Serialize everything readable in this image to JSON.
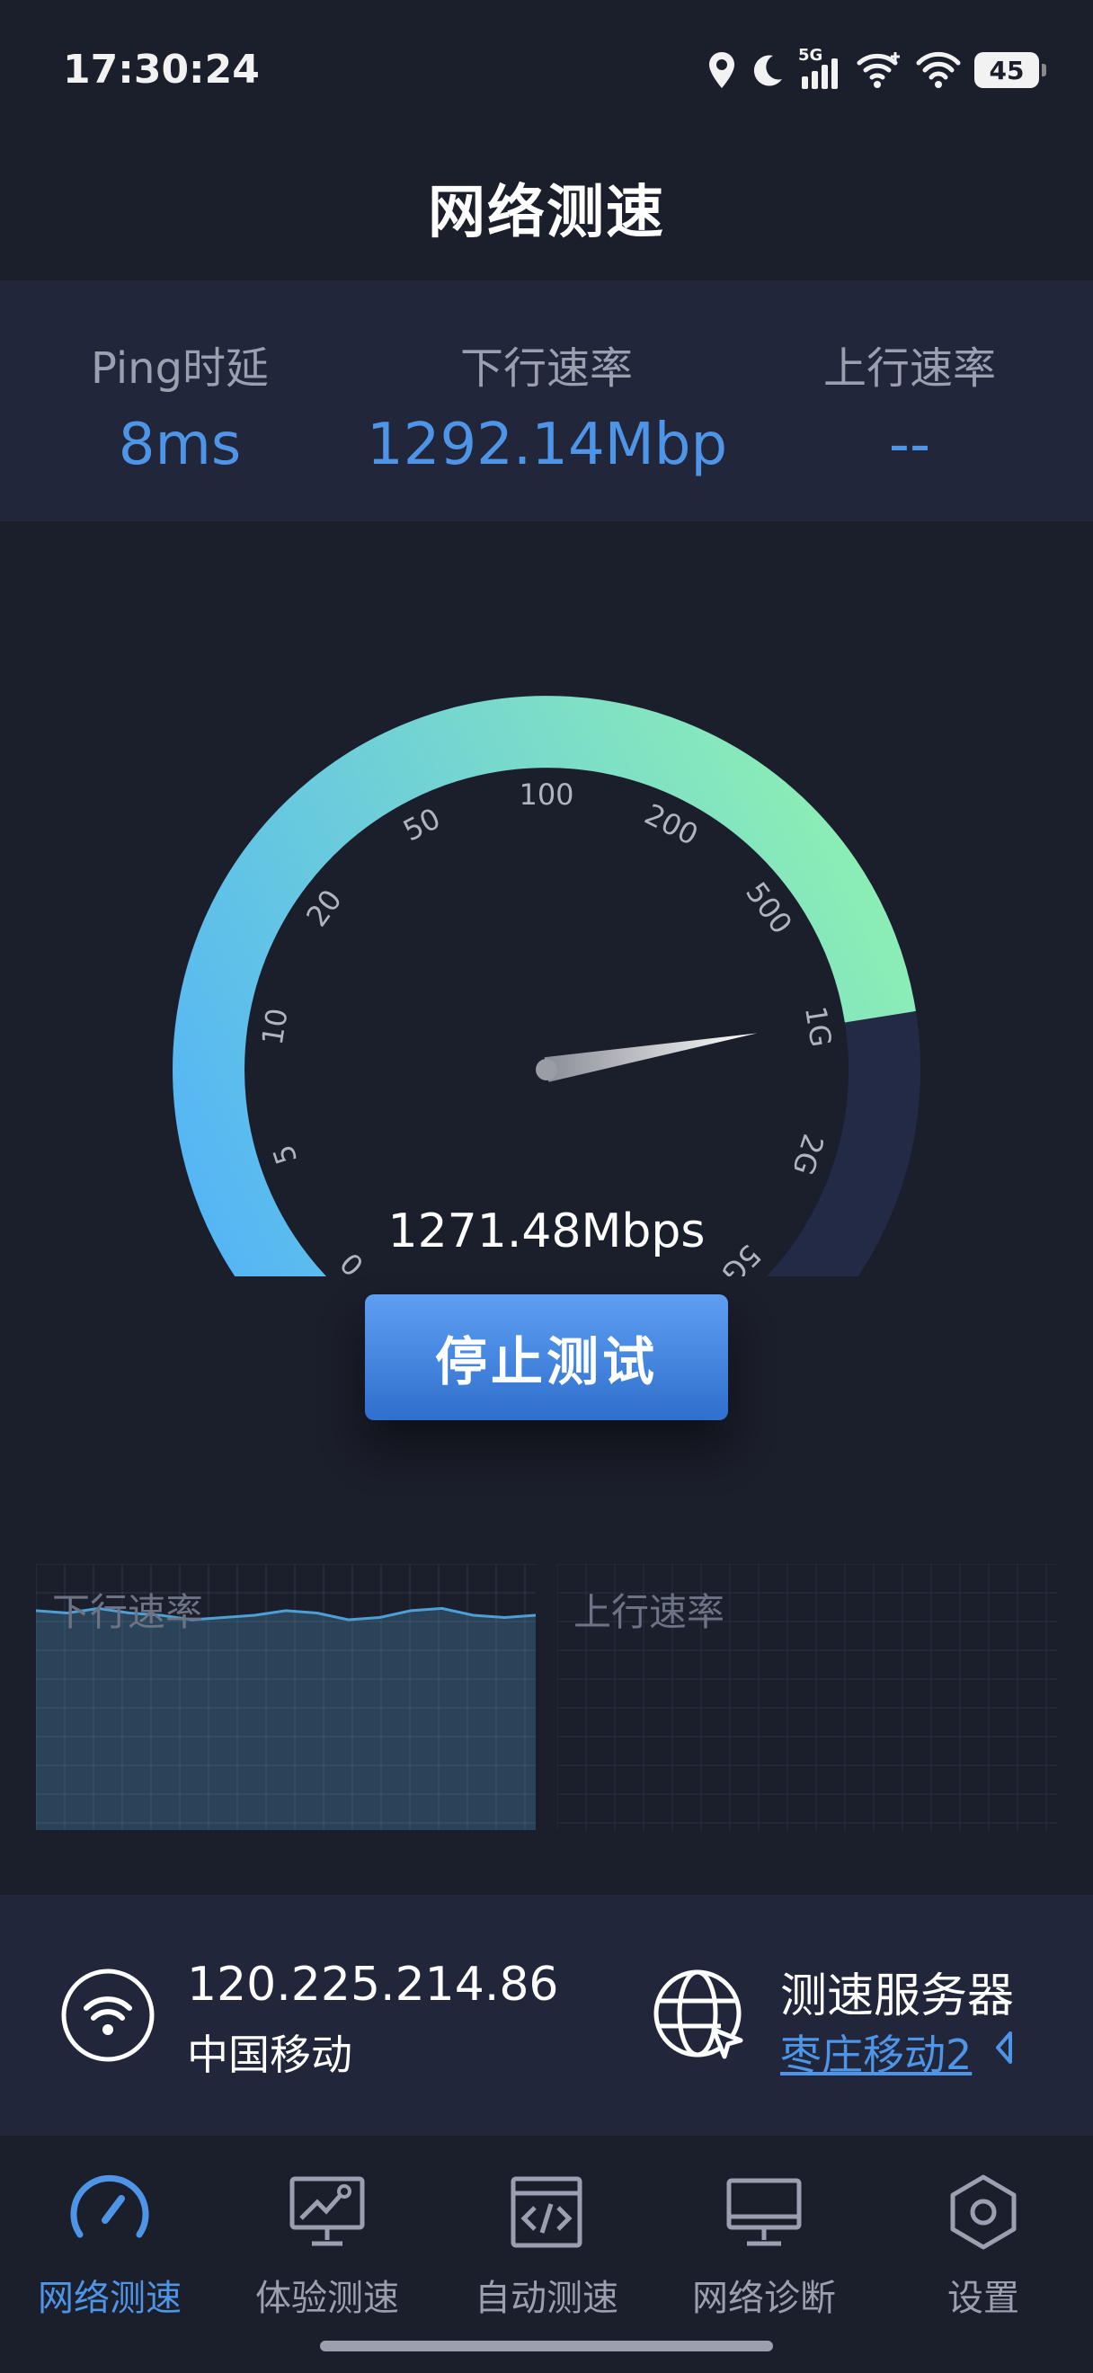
{
  "status_bar": {
    "time": "17:30:24",
    "network": "5G",
    "battery": "45",
    "icons": [
      "location-icon",
      "moon-icon",
      "5g-signal-icon",
      "wifi-plus-icon",
      "wifi-icon",
      "battery-icon"
    ]
  },
  "header": {
    "title": "网络测速"
  },
  "stats": {
    "ping": {
      "label": "Ping时延",
      "value": "8ms"
    },
    "download": {
      "label": "下行速率",
      "value": "1292.14Mbp"
    },
    "upload": {
      "label": "上行速率",
      "value": "--"
    }
  },
  "gauge": {
    "ticks": [
      "0",
      "5",
      "10",
      "20",
      "50",
      "100",
      "200",
      "500",
      "1G",
      "2G",
      "5G"
    ],
    "progress_fraction": 0.8,
    "needle_fraction": 0.797,
    "readout": "1271.48Mbps",
    "colors": {
      "start": "#55b6f5",
      "end": "#8ef0b2",
      "track": "#232a46",
      "tick_text": "#b0b4c0"
    }
  },
  "controls": {
    "stop_label": "停止测试"
  },
  "charts": {
    "download": {
      "label": "下行速率",
      "line_color": "#4e9fd6",
      "fill_color": "#2a4358",
      "fill_fraction": 0.85,
      "line_values": [
        0.97,
        0.96,
        0.98,
        0.96,
        0.95,
        0.93,
        0.94,
        0.95,
        0.97,
        0.96,
        0.93,
        0.94,
        0.97,
        0.98,
        0.95,
        0.94,
        0.95
      ]
    },
    "upload": {
      "label": "上行速率"
    }
  },
  "info": {
    "ip": "120.225.214.86",
    "isp": "中国移动",
    "server_title": "测速服务器",
    "server_name": "枣庄移动2"
  },
  "nav": {
    "items": [
      {
        "label": "网络测速",
        "icon": "speedometer-icon",
        "active": true
      },
      {
        "label": "体验测速",
        "icon": "monitor-chart-icon",
        "active": false
      },
      {
        "label": "自动测速",
        "icon": "code-window-icon",
        "active": false
      },
      {
        "label": "网络诊断",
        "icon": "desktop-icon",
        "active": false
      },
      {
        "label": "设置",
        "icon": "settings-hex-icon",
        "active": false
      }
    ]
  },
  "colors": {
    "background": "#1b1e2b",
    "panel": "#22263a",
    "accent": "#4e95e8",
    "label": "#9aa0b0"
  }
}
